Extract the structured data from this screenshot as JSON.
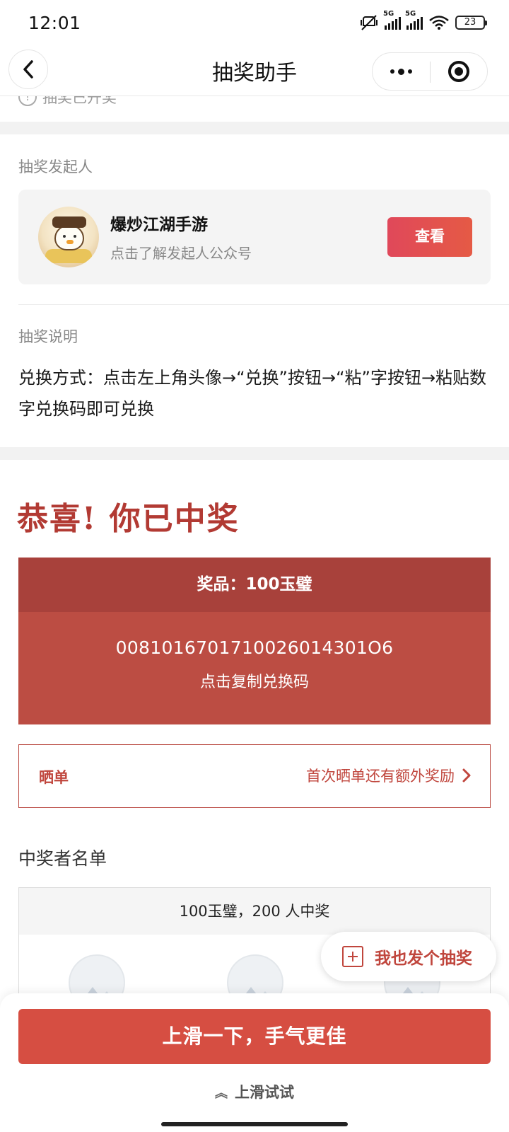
{
  "status_bar": {
    "time": "12:01",
    "network_1": "5G",
    "network_2": "5G",
    "battery": "23",
    "icons": [
      "mute-vibrate-icon",
      "signal-icon",
      "signal-icon",
      "wifi-icon",
      "battery-icon"
    ]
  },
  "nav": {
    "title": "抽奖助手",
    "back_icon": "chevron-left-icon",
    "more_icon": "more-dots-icon",
    "close_icon": "target-icon"
  },
  "cutoff_status": "抽奖已开奖",
  "initiator": {
    "section_label": "抽奖发起人",
    "name": "爆炒江湖手游",
    "subtitle": "点击了解发起人公众号",
    "view_button": "查看"
  },
  "description": {
    "section_label": "抽奖说明",
    "text": "兑换方式：点击左上角头像→“兑换”按钮→“粘”字按钮→粘贴数字兑换码即可兑换"
  },
  "result": {
    "congrats": "恭喜! 你已中奖",
    "prize_label": "奖品：100玉璧",
    "code": "0081016701710026014301O6",
    "copy_hint": "点击复制兑换码"
  },
  "share": {
    "title": "晒单",
    "hint": "首次晒单还有额外奖励"
  },
  "winners": {
    "title": "中奖者名单",
    "summary": "100玉璧，200 人中奖"
  },
  "fab": {
    "label": "我也发个抽奖"
  },
  "bottom": {
    "cta": "上滑一下，手气更佳",
    "swipe_hint": "上滑试试"
  },
  "colors": {
    "accent_red": "#c0463d",
    "prize_bg": "#bc4d43",
    "prize_head_bg": "#a8413b",
    "cta_bg": "#d64e42"
  }
}
